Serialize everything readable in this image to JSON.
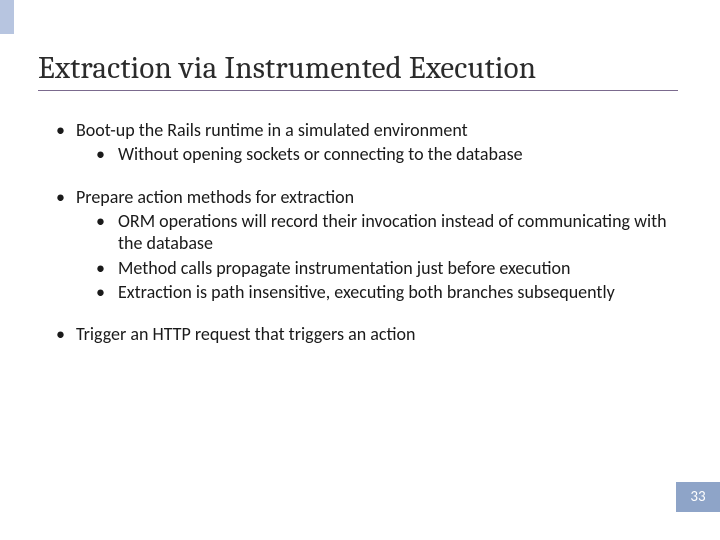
{
  "title": "Extraction via Instrumented Execution",
  "bullets": [
    {
      "text": "Boot-up the Rails runtime in a simulated environment",
      "sub": [
        "Without opening sockets or connecting to the database"
      ]
    },
    {
      "text": "Prepare action methods for extraction",
      "sub": [
        "ORM operations will record their invocation instead of communicating with the database",
        "Method calls propagate instrumentation just before execution",
        "Extraction is path insensitive, executing both branches subsequently"
      ]
    },
    {
      "text": "Trigger an HTTP request that triggers an action",
      "sub": []
    }
  ],
  "page_number": "33"
}
